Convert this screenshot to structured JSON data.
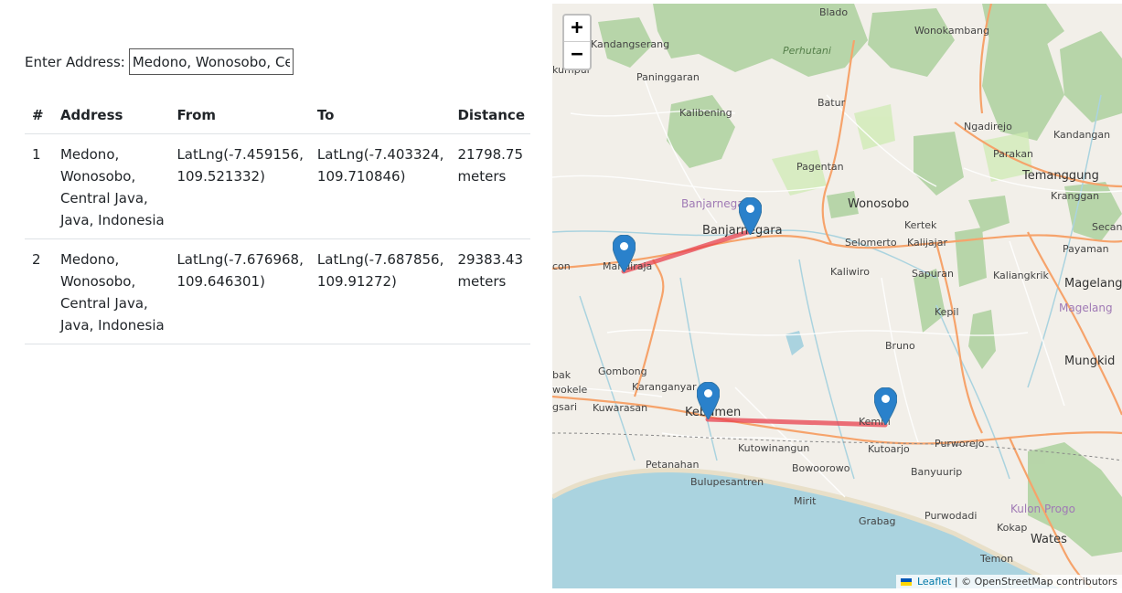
{
  "form": {
    "label": "Enter Address:",
    "value": "Medono, Wonosobo, Central Java, Java, Indonesia"
  },
  "table": {
    "headers": [
      "#",
      "Address",
      "From",
      "To",
      "Distance"
    ],
    "rows": [
      {
        "num": "1",
        "address": "Medono, Wonosobo, Central Java, Java, Indonesia",
        "from": "LatLng(-7.459156, 109.521332)",
        "to": "LatLng(-7.403324, 109.710846)",
        "distance": "21798.75 meters"
      },
      {
        "num": "2",
        "address": "Medono, Wonosobo, Central Java, Java, Indonesia",
        "from": "LatLng(-7.676968, 109.646301)",
        "to": "LatLng(-7.687856, 109.91272)",
        "distance": "29383.43 meters"
      }
    ]
  },
  "map": {
    "zoom_in": "+",
    "zoom_out": "−",
    "attribution_link": "Leaflet",
    "attribution_text": "| © OpenStreetMap contributors",
    "route_color": "#e8424d",
    "marker_color": "#2a81cb",
    "labels": {
      "blado": "Blado",
      "wonokambang": "Wonokambang",
      "kandangserang": "Kandangserang",
      "perhutani": "Perhutani",
      "kumpul": "kumpul",
      "paninggaran": "Paninggaran",
      "batur": "Batur",
      "kalibening": "Kalibening",
      "ngadirejo": "Ngadirejo",
      "kandangan": "Kandangan",
      "parakan": "Parakan",
      "pagentan": "Pagentan",
      "temanggung": "Temanggung",
      "kranggan": "Kranggan",
      "banjarnegara_region": "Banjarnegara",
      "wonosobo": "Wonosobo",
      "banjarnegara": "Banjarnegara",
      "kertek": "Kertek",
      "secang": "Secang",
      "selomerto": "Selomerto",
      "kalijajar": "Kalijajar",
      "mandiraja": "Mandiraja",
      "payaman": "Payaman",
      "kaliwiro": "Kaliwiro",
      "sapuran": "Sapuran",
      "kaliangkrik": "Kaliangkrik",
      "magelang": "Magelang",
      "magelang_region": "Magelang",
      "kepil": "Kepil",
      "bruno": "Bruno",
      "mungkid": "Mungkid",
      "gombong": "Gombong",
      "bak": "bak",
      "wokele": "wokele",
      "karanganyar": "Karanganyar",
      "gsari": "gsari",
      "kuwarasan": "Kuwarasan",
      "kebumen": "Kebumen",
      "kemiri": "Kemiri",
      "kutowinangun": "Kutowinangun",
      "kutoarjo": "Kutoarjo",
      "purworejo": "Purworejo",
      "petanahan": "Petanahan",
      "bulupesantren": "Bulupesantren",
      "bowoorowo": "Bowoorowo",
      "banyuurip": "Banyuurip",
      "mirit": "Mirit",
      "kulon_progo": "Kulon Progo",
      "grabag": "Grabag",
      "purwodadi": "Purwodadi",
      "kokap": "Kokap",
      "wates": "Wates",
      "temon": "Temon",
      "con": "con"
    }
  }
}
